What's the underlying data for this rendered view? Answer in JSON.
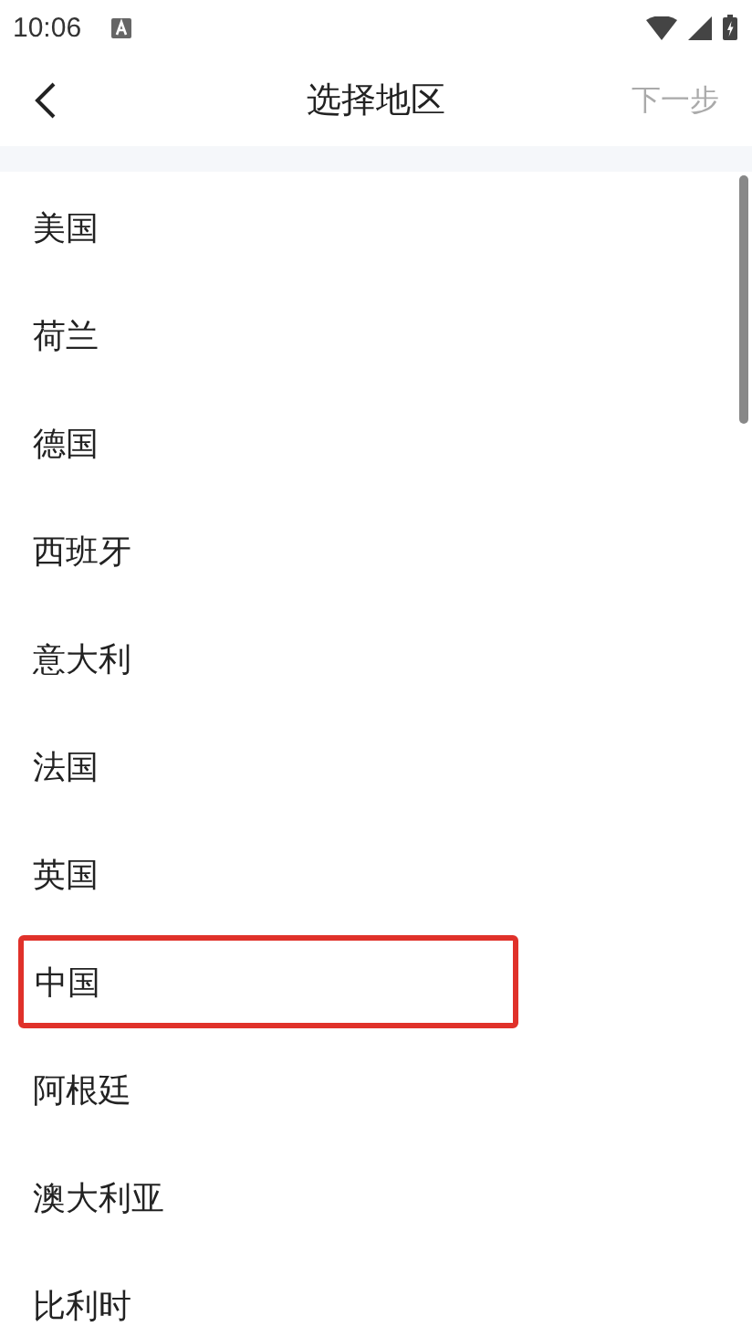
{
  "status_bar": {
    "time": "10:06"
  },
  "header": {
    "title": "选择地区",
    "next_button": {
      "label": "下一步",
      "disabled": true
    }
  },
  "regions": [
    {
      "name": "美国",
      "highlighted": false
    },
    {
      "name": "荷兰",
      "highlighted": false
    },
    {
      "name": "德国",
      "highlighted": false
    },
    {
      "name": "西班牙",
      "highlighted": false
    },
    {
      "name": "意大利",
      "highlighted": false
    },
    {
      "name": "法国",
      "highlighted": false
    },
    {
      "name": "英国",
      "highlighted": false
    },
    {
      "name": "中国",
      "highlighted": true
    },
    {
      "name": "阿根廷",
      "highlighted": false
    },
    {
      "name": "澳大利亚",
      "highlighted": false
    },
    {
      "name": "比利时",
      "highlighted": false
    }
  ]
}
